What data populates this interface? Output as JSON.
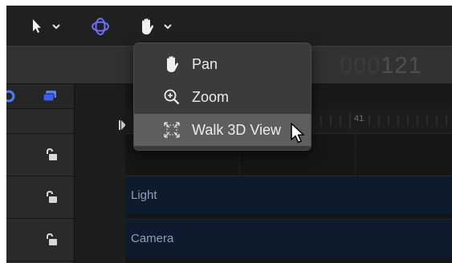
{
  "toolbar": {
    "select_tool": "select-arrow",
    "orbit_tool": "3d-orbit",
    "hand_tool": "pan-hand",
    "accent_color": "#6b6bff"
  },
  "timecode": {
    "prefix": "000",
    "value": "121"
  },
  "timeline": {
    "ruler_label": "41",
    "tracks": [
      {
        "label": "Light"
      },
      {
        "label": "Camera"
      }
    ]
  },
  "menu": {
    "items": [
      {
        "label": "Pan",
        "icon": "hand-icon"
      },
      {
        "label": "Zoom",
        "icon": "zoom-icon"
      },
      {
        "label": "Walk 3D View",
        "icon": "walk-3d-icon",
        "selected": true
      }
    ]
  }
}
